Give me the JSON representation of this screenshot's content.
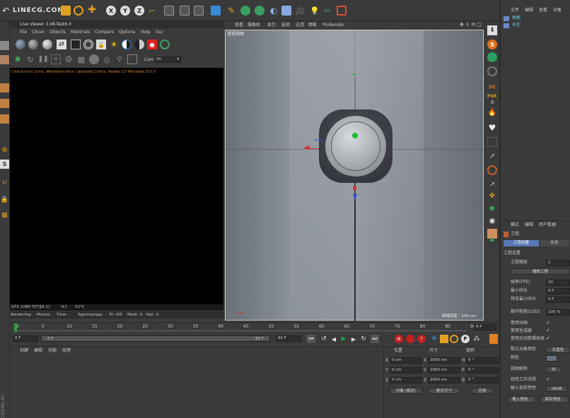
{
  "top_toolbar": {
    "logo": "LINECG.COM",
    "axis_x": "X",
    "axis_y": "Y",
    "axis_z": "Z"
  },
  "live_viewer": {
    "title": "Live Viewer 3.08-Test6.0",
    "menu": [
      "File",
      "Cloud",
      "Objects",
      "Materials",
      "Compare",
      "Options",
      "Help",
      "Gui"
    ],
    "cam_label": "Cam",
    "cam_value": "DL",
    "status": "Check:0ms./1ms. MeshGen:0ms. Update[C]:0ms. Nodes:17 Movable:3  0 0",
    "gpu": "GTX 1080 Ti[T][6.1]",
    "gpu_pct": "%7",
    "gpu_temp": "52°C",
    "footer": [
      "Rendering:",
      "Ms/sec: -",
      "Time: -",
      "Spp/maxspp: -",
      "Tri: 0/0",
      "Mesh: 0",
      "Hair: 0"
    ]
  },
  "viewport": {
    "menu": [
      "查看",
      "摄像机",
      "显示",
      "选项",
      "过滤",
      "面板",
      "ProRender"
    ],
    "label": "透视视图",
    "grid_info": "网格间距 : 100 cm"
  },
  "timeline": {
    "ticks": [
      "0",
      "5",
      "10",
      "15",
      "20",
      "25",
      "30",
      "35",
      "40",
      "45",
      "50",
      "55",
      "60",
      "65",
      "70",
      "75",
      "80",
      "85",
      "90"
    ],
    "current_frame": "0 F",
    "start": "0 F",
    "slider_start": "0 F",
    "slider_end": "90 F",
    "end": "90 F",
    "end_field": "90 F"
  },
  "materials": {
    "menu": [
      "创建",
      "编辑",
      "功能",
      "纹理"
    ]
  },
  "coords": {
    "headers": [
      "位置",
      "尺寸",
      "旋转"
    ],
    "rows": [
      {
        "axis": "X",
        "pos": "0 cm",
        "size": "2000 cm",
        "rot_label": "H",
        "rot": "0 °"
      },
      {
        "axis": "Y",
        "pos": "0 cm",
        "size": "2000 cm",
        "rot_label": "P",
        "rot": "0 °"
      },
      {
        "axis": "Z",
        "pos": "0 cm",
        "size": "2000 cm",
        "rot_label": "B",
        "rot": "0 °"
      }
    ],
    "mode1": "对象 (相对)",
    "mode2": "绝对尺寸",
    "apply": "应用"
  },
  "object_manager": {
    "menu": [
      "文件",
      "编辑",
      "查看",
      "对象"
    ],
    "items": [
      "地面",
      "天空"
    ]
  },
  "attributes": {
    "menu": [
      "模式",
      "编辑",
      "用户数据"
    ],
    "title": "工程",
    "tabs": [
      "工程设置",
      "信息"
    ],
    "section": "工程设置",
    "rows": [
      {
        "label": "工程缩放",
        "value": "1"
      },
      {
        "label": "",
        "button": "缩放工程"
      },
      {
        "label": "帧率(FPS)",
        "value": "30"
      },
      {
        "label": "最小时长",
        "value": "0 F"
      },
      {
        "label": "预览最小时长",
        "value": "0 F"
      },
      {
        "label": "细节程度(LOD)",
        "value": "100 %"
      },
      {
        "label": "使用动画",
        "check": "✓"
      },
      {
        "label": "使用生成器",
        "check": "✓"
      },
      {
        "label": "使用运动剪辑系统",
        "check": "✓"
      },
      {
        "label": "默认对象颜色",
        "value": "灰蓝色"
      },
      {
        "label": "颜色",
        "value": ""
      },
      {
        "label": "视图修剪",
        "value": "中"
      },
      {
        "label": "线性工作流程",
        "check": "✓"
      },
      {
        "label": "输入色彩特性",
        "value": "sRGB"
      }
    ],
    "load": "载入预设...",
    "save": "保存预设..."
  },
  "side_label": "CINEMA 4D"
}
